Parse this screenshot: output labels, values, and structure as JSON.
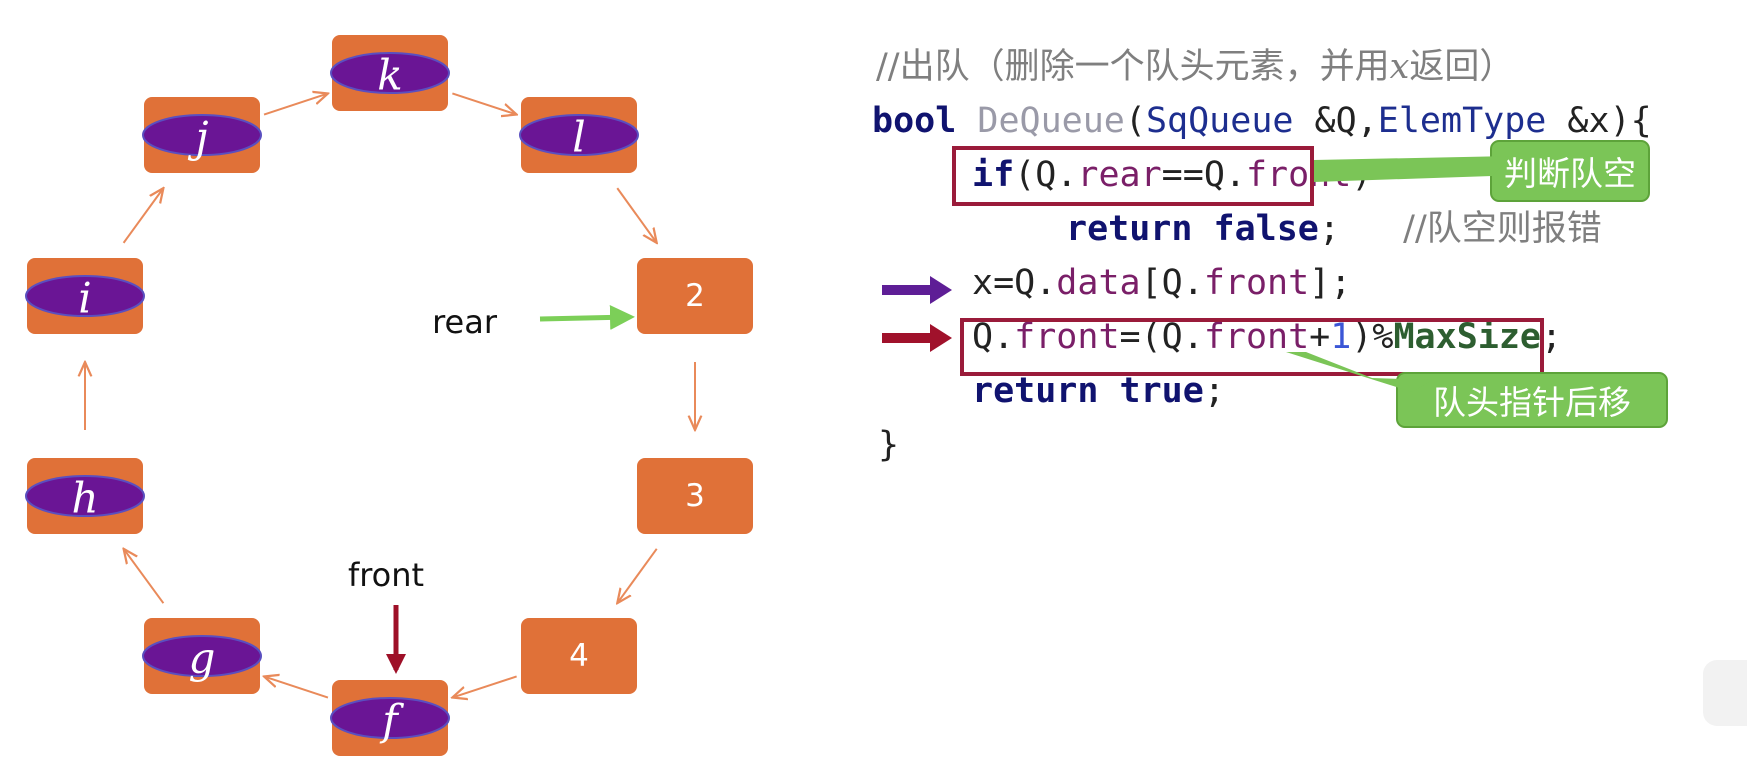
{
  "ring": {
    "nodes": [
      {
        "id": "k",
        "label": "k",
        "is_var": true
      },
      {
        "id": "l",
        "label": "l",
        "is_var": true
      },
      {
        "id": "2",
        "label": "2",
        "is_var": false
      },
      {
        "id": "3",
        "label": "3",
        "is_var": false
      },
      {
        "id": "4",
        "label": "4",
        "is_var": false
      },
      {
        "id": "f",
        "label": "f",
        "is_var": true
      },
      {
        "id": "g",
        "label": "g",
        "is_var": true
      },
      {
        "id": "h",
        "label": "h",
        "is_var": true
      },
      {
        "id": "i",
        "label": "i",
        "is_var": true
      },
      {
        "id": "j",
        "label": "j",
        "is_var": true
      }
    ],
    "rear_label": "rear",
    "front_label": "front",
    "colors": {
      "node": "#e07138",
      "oval": "#6a1595",
      "oval_stroke": "#5a4fc0",
      "edge": "#e98a5a",
      "rear_arrow": "#7ccf58",
      "front_arrow": "#9e1028"
    }
  },
  "code": {
    "comment_1": "//出队（删除一个队头元素，并用",
    "comment_1_var": "x",
    "comment_1_tail": "返回）",
    "l2_kw": "bool",
    "l2_fn": "DeQueue",
    "l2_p1": "(",
    "l2_t1": "SqQueue",
    "l2_p2": " &Q,",
    "l2_t2": "ElemType",
    "l2_p3": " &x){",
    "l3_kw": "if",
    "l3_a": "(Q.",
    "l3_f1": "rear",
    "l3_b": "==Q.",
    "l3_f2": "front",
    "l3_c": ")",
    "l4_kw1": "return",
    "l4_kw2": "false",
    "l4_semi": ";",
    "l4_comment": "//队空则报错",
    "l5_a": "x=Q.",
    "l5_f1": "data",
    "l5_b": "[Q.",
    "l5_f2": "front",
    "l5_c": "];",
    "l6_a": "Q.",
    "l6_f1": "front",
    "l6_b": "=(Q.",
    "l6_f2": "front",
    "l6_c": "+",
    "l6_num": "1",
    "l6_d": ")%",
    "l6_mac": "MaxSize",
    "l6_e": ";",
    "l7_kw1": "return",
    "l7_kw2": "true",
    "l7_semi": ";",
    "l8": "}"
  },
  "callouts": {
    "empty_check": "判断队空",
    "front_move": "队头指针后移"
  },
  "arrow_colors": {
    "purple": "#5e1e96",
    "red": "#a0112b"
  }
}
